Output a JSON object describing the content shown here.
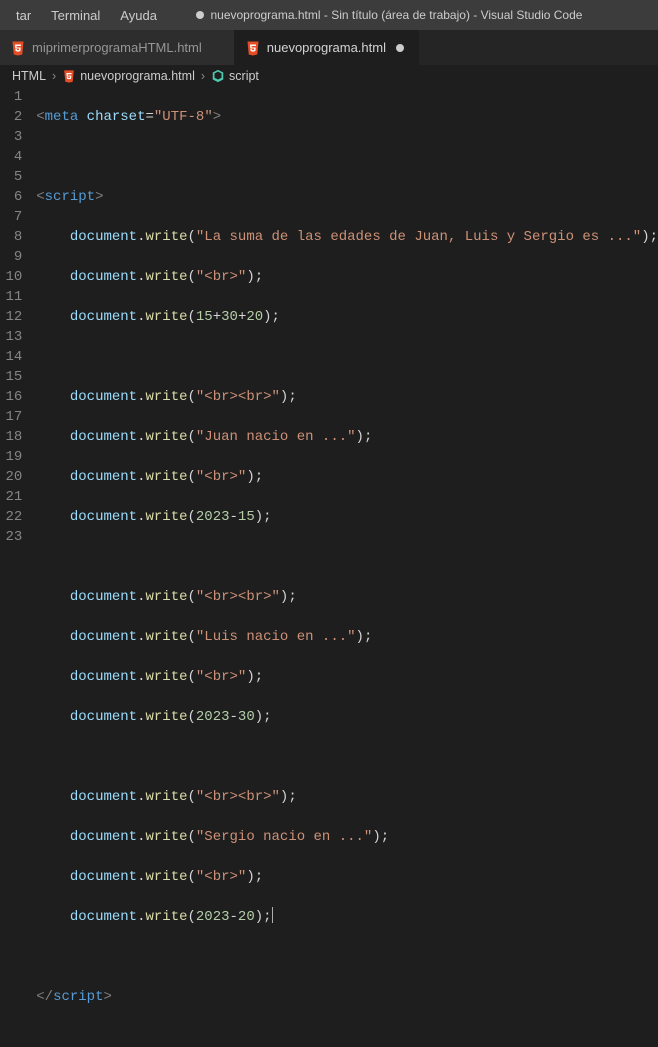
{
  "menu": {
    "item1": "tar",
    "item2": "Terminal",
    "item3": "Ayuda"
  },
  "title": "nuevoprograma.html - Sin título (área de trabajo) - Visual Studio Code",
  "tabs": [
    {
      "label": "miprimerprogramaHTML.html",
      "active": false,
      "dirty": false
    },
    {
      "label": "nuevoprograma.html",
      "active": true,
      "dirty": true
    }
  ],
  "breadcrumbs": {
    "root": "HTML",
    "file": "nuevoprograma.html",
    "symbol": "script"
  },
  "code": {
    "meta_charset_value": "UTF-8",
    "lines": [
      {
        "n": 1
      },
      {
        "n": 2
      },
      {
        "n": 3
      },
      {
        "n": 4
      },
      {
        "n": 5
      },
      {
        "n": 6
      },
      {
        "n": 7
      },
      {
        "n": 8
      },
      {
        "n": 9
      },
      {
        "n": 10
      },
      {
        "n": 11
      },
      {
        "n": 12
      },
      {
        "n": 13
      },
      {
        "n": 14
      },
      {
        "n": 15
      },
      {
        "n": 16
      },
      {
        "n": 17
      },
      {
        "n": 18
      },
      {
        "n": 19
      },
      {
        "n": 20
      },
      {
        "n": 21
      },
      {
        "n": 22
      },
      {
        "n": 23
      }
    ],
    "strings": {
      "s4": "\"La suma de las edades de Juan, Luis y Sergio es ...\"",
      "br": "\"<br>\"",
      "brbr": "\"<br><br>\"",
      "s9": "\"Juan nacio en ...\"",
      "s14": "\"Luis nacio en ...\"",
      "s19": "\"Sergio nacio en ...\""
    },
    "exprs": {
      "e6": {
        "a": "15",
        "b": "30",
        "c": "20",
        "op": "+"
      },
      "e11": {
        "a": "2023",
        "b": "15",
        "op": "-"
      },
      "e16": {
        "a": "2023",
        "b": "30",
        "op": "-"
      },
      "e21": {
        "a": "2023",
        "b": "20",
        "op": "-"
      }
    },
    "tokens": {
      "meta": "meta",
      "charset": "charset",
      "script": "script",
      "document": "document",
      "write": "write"
    }
  }
}
